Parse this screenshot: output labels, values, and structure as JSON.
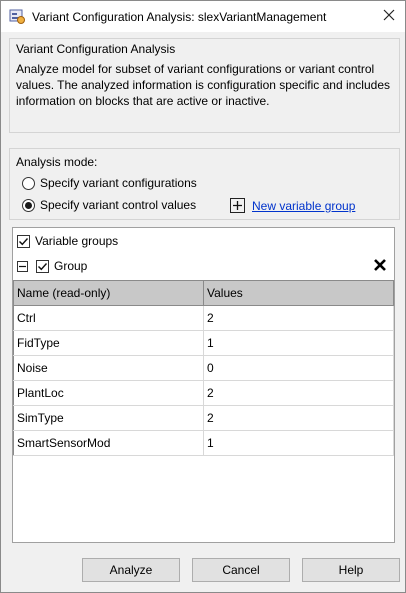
{
  "window": {
    "title": "Variant Configuration Analysis: slexVariantManagement"
  },
  "info": {
    "heading": "Variant Configuration Analysis",
    "description": "Analyze model for subset of variant configurations or variant control values. The analyzed information is configuration specific and includes information on blocks that are active or inactive."
  },
  "mode": {
    "label": "Analysis mode:",
    "options": [
      {
        "label": "Specify variant configurations",
        "selected": false
      },
      {
        "label": "Specify variant control values",
        "selected": true
      }
    ],
    "new_group_link": "New variable group"
  },
  "groups": {
    "label": "Variable groups",
    "checked": true,
    "group_name": "Group",
    "group_checked": true,
    "columns": [
      "Name (read-only)",
      "Values"
    ],
    "rows": [
      {
        "name": "Ctrl",
        "value": "2"
      },
      {
        "name": "FidType",
        "value": "1"
      },
      {
        "name": "Noise",
        "value": "0"
      },
      {
        "name": "PlantLoc",
        "value": "2"
      },
      {
        "name": "SimType",
        "value": "2"
      },
      {
        "name": "SmartSensorMod",
        "value": "1"
      }
    ]
  },
  "buttons": {
    "analyze": "Analyze",
    "cancel": "Cancel",
    "help": "Help"
  },
  "icons": {
    "app": "variant-analysis-icon",
    "close": "close-icon",
    "add": "plus-icon",
    "delete": "delete-icon",
    "collapse": "collapse-icon"
  }
}
